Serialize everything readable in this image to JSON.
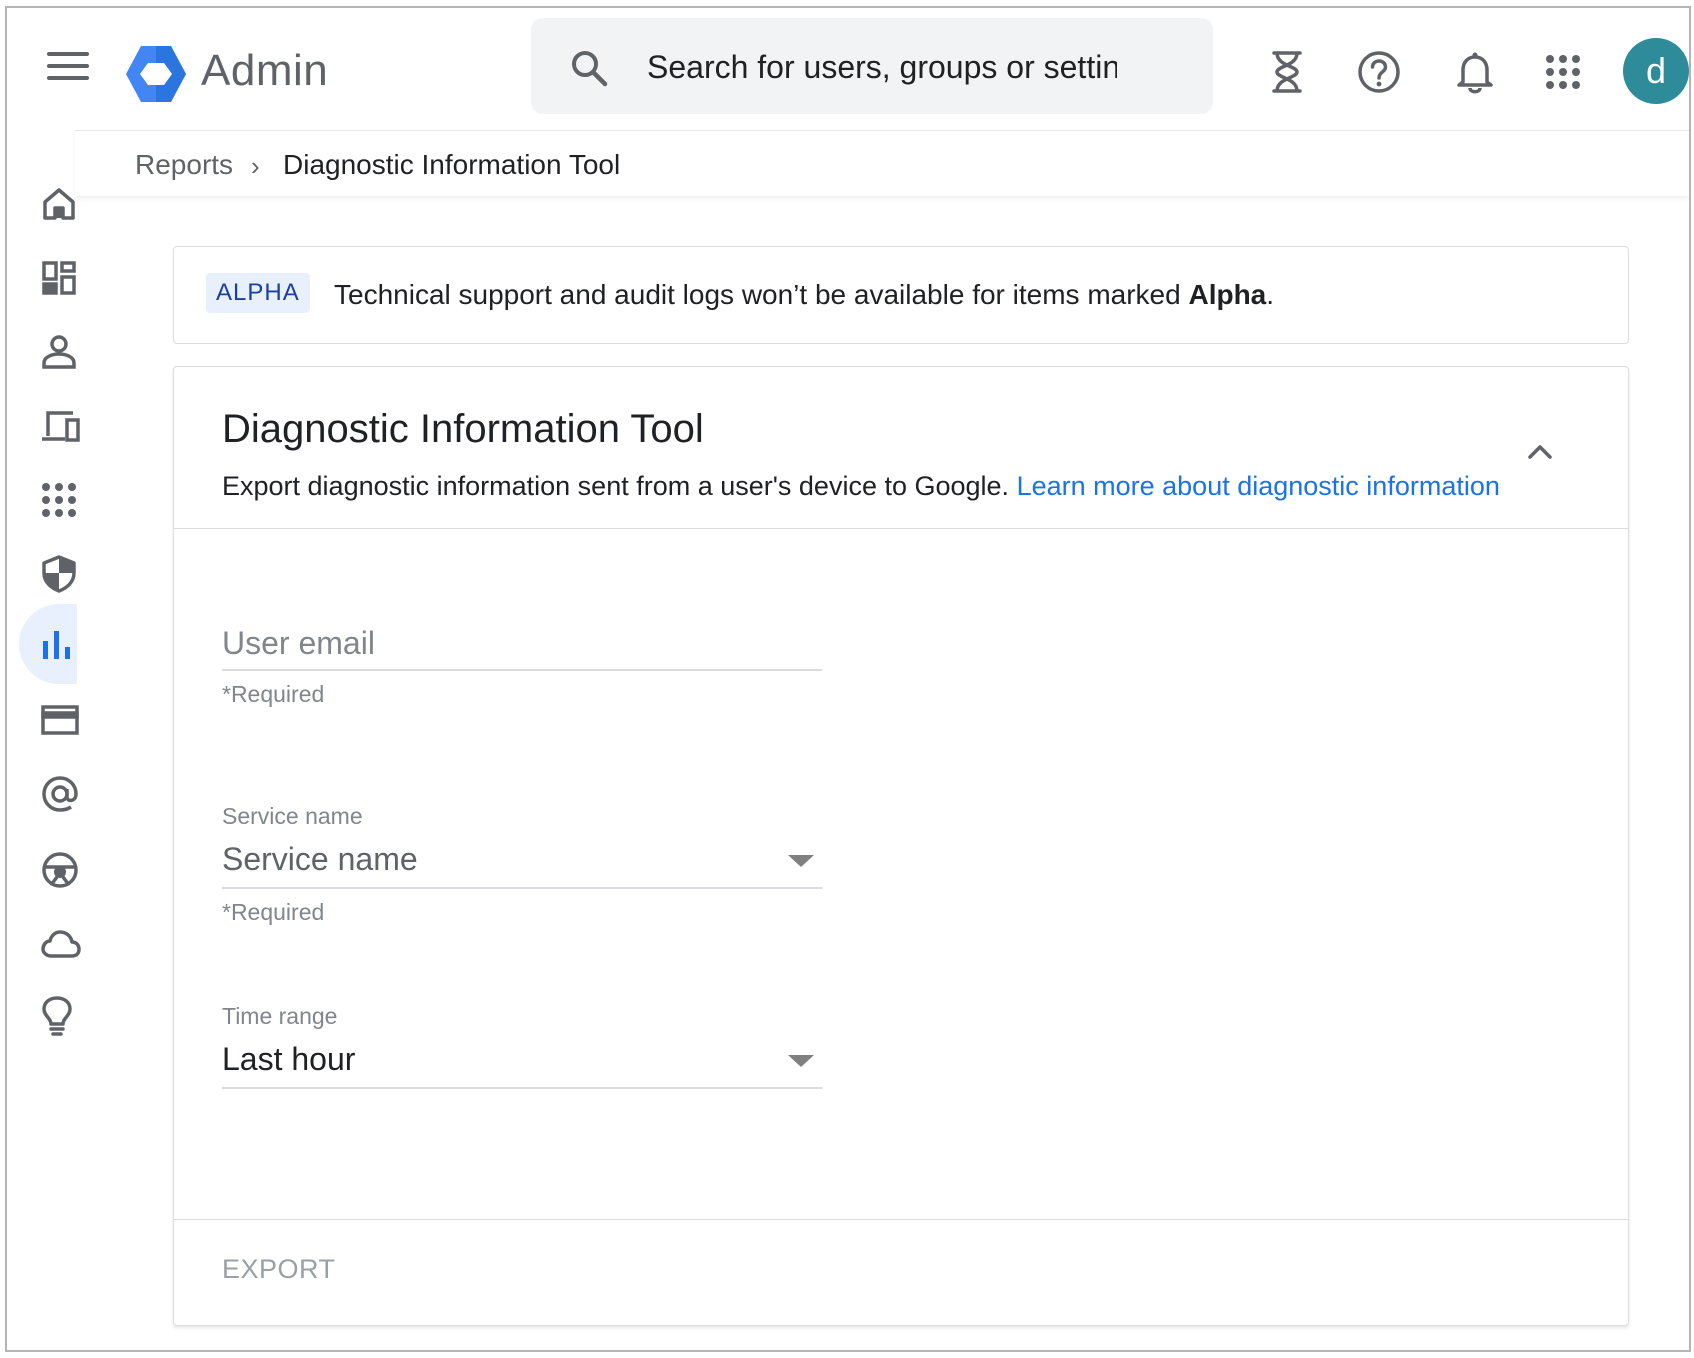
{
  "app": {
    "name": "Admin",
    "avatar_initial": "d"
  },
  "search": {
    "placeholder": "Search for users, groups or settings"
  },
  "topbar_icons": [
    "hourglass-icon",
    "help-icon",
    "notifications-icon",
    "apps-grid-icon"
  ],
  "breadcrumb": {
    "parent": "Reports",
    "separator": "›",
    "current": "Diagnostic Information Tool"
  },
  "sidenav": {
    "items": [
      {
        "icon": "home-icon"
      },
      {
        "icon": "dashboard-icon"
      },
      {
        "icon": "users-icon"
      },
      {
        "icon": "devices-icon"
      },
      {
        "icon": "apps-icon"
      },
      {
        "icon": "security-shield-icon"
      },
      {
        "icon": "reports-chart-icon",
        "active": true
      },
      {
        "icon": "billing-card-icon"
      },
      {
        "icon": "account-at-icon"
      },
      {
        "icon": "rules-icon"
      },
      {
        "icon": "storage-cloud-icon"
      },
      {
        "icon": "lightbulb-icon"
      }
    ]
  },
  "alpha_notice": {
    "badge": "ALPHA",
    "text_prefix": "Technical support and audit logs won’t be available for items marked ",
    "text_bold": "Alpha",
    "text_suffix": "."
  },
  "tool": {
    "title": "Diagnostic Information Tool",
    "description": "Export diagnostic information sent from a user's device to Google.",
    "learn_more": "Learn more about diagnostic information",
    "fields": {
      "user_email": {
        "placeholder": "User email",
        "helper": "*Required",
        "value": ""
      },
      "service_name": {
        "label": "Service name",
        "value": "Service name",
        "helper": "*Required"
      },
      "time_range": {
        "label": "Time range",
        "value": "Last hour"
      }
    },
    "export_label": "EXPORT"
  },
  "colors": {
    "accent": "#1a73e8",
    "avatar": "#2e8b9a",
    "nav_active_bg": "#e8f0fe",
    "logo_blue": "#4285f4"
  }
}
